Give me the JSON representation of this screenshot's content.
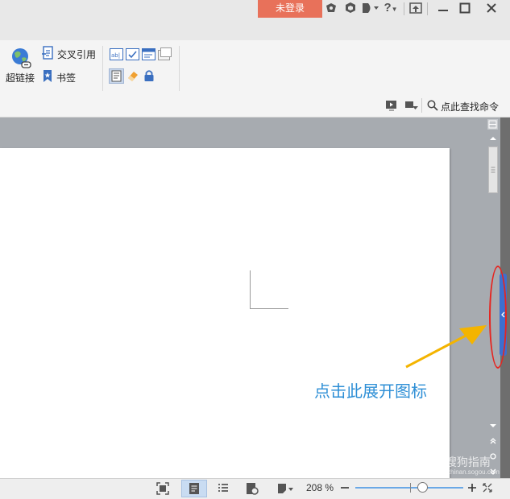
{
  "titlebar": {
    "login_label": "未登录",
    "help_label": "?"
  },
  "ribbon": {
    "hyperlink_label": "超链接",
    "cross_ref_label": "交叉引用",
    "bookmark_label": "书签",
    "search_command_label": "点此查找命令"
  },
  "statusbar": {
    "zoom": "208 %"
  },
  "annotation": {
    "caption": "点击此展开图标"
  },
  "watermark": {
    "text": "搜狗指南",
    "url": "zhinan.sogou.com"
  },
  "colors": {
    "login_bg": "#e8715a",
    "annotation_text": "#2e8fd6",
    "annotation_circle": "#e52520",
    "side_tab": "#3d6fcf"
  }
}
